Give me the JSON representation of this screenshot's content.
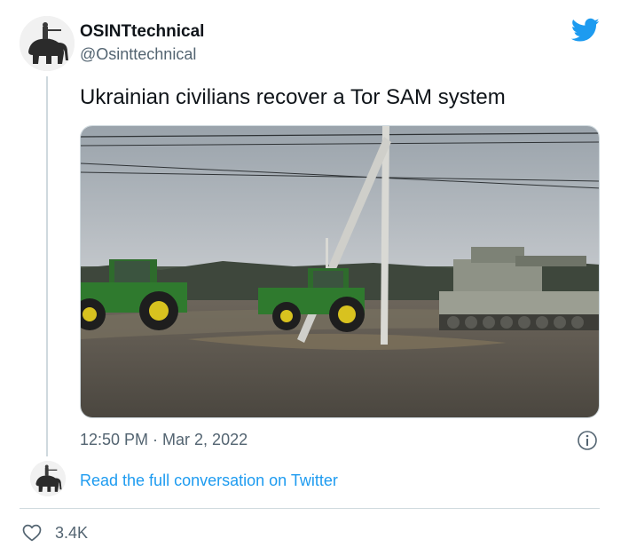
{
  "tweet": {
    "display_name": "OSINTtechnical",
    "handle": "@Osinttechnical",
    "text": "Ukrainian civilians recover a Tor SAM system",
    "timestamp": "12:50 PM · Mar 2, 2022",
    "read_more_label": "Read the full conversation on Twitter",
    "like_count": "3.4K"
  },
  "icons": {
    "brand": "twitter-bird-icon",
    "info": "info-icon",
    "like": "heart-icon"
  },
  "colors": {
    "brand": "#1d9bf0",
    "text_primary": "#0f1419",
    "text_secondary": "#536471",
    "border": "#cfd9de"
  }
}
